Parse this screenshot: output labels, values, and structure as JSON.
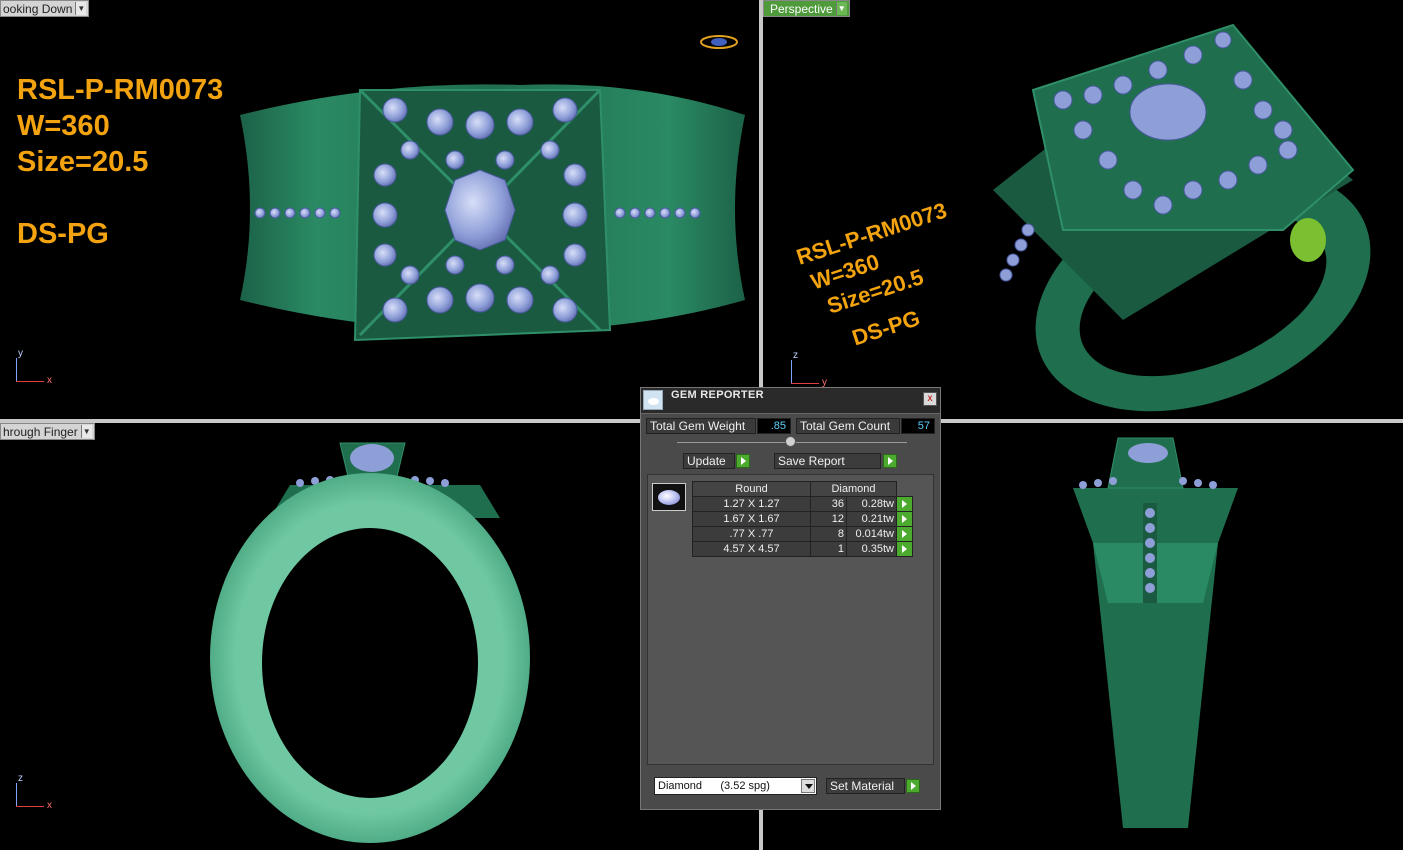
{
  "viewports": {
    "top": {
      "label": "ooking Down"
    },
    "perspective": {
      "label": "Perspective"
    },
    "front": {
      "label": "hrough Finger"
    },
    "side": {
      "label": ""
    }
  },
  "annotation": {
    "model": "RSL-P-RM0073",
    "weight": "W=360",
    "size": "Size=20.5",
    "metal": "DS-PG"
  },
  "axes": {
    "top": {
      "v": "y",
      "h": "x"
    },
    "perspective": {
      "v": "z",
      "h": "y"
    },
    "front": {
      "v": "z",
      "h": "x"
    }
  },
  "gem_reporter": {
    "title": "GEM REPORTER",
    "close": "x",
    "total_weight_label": "Total Gem Weight",
    "total_weight_value": ".85",
    "total_count_label": "Total Gem Count",
    "total_count_value": "57",
    "update_label": "Update",
    "save_report_label": "Save Report",
    "table_header": {
      "shape": "Round",
      "type": "Diamond"
    },
    "rows": [
      {
        "size": "1.27 X 1.27",
        "count": "36",
        "weight": "0.28tw"
      },
      {
        "size": "1.67 X 1.67",
        "count": "12",
        "weight": "0.21tw"
      },
      {
        "size": ".77 X .77",
        "count": "8",
        "weight": "0.014tw"
      },
      {
        "size": "4.57 X 4.57",
        "count": "1",
        "weight": "0.35tw"
      }
    ],
    "material_select": "Diamond      (3.52 spg)",
    "set_material_label": "Set Material"
  },
  "colors": {
    "metal": "#1f6e4e",
    "gem": "#8e9fd8",
    "annotation": "#f2a30f",
    "active_label": "#4f9a3b"
  }
}
